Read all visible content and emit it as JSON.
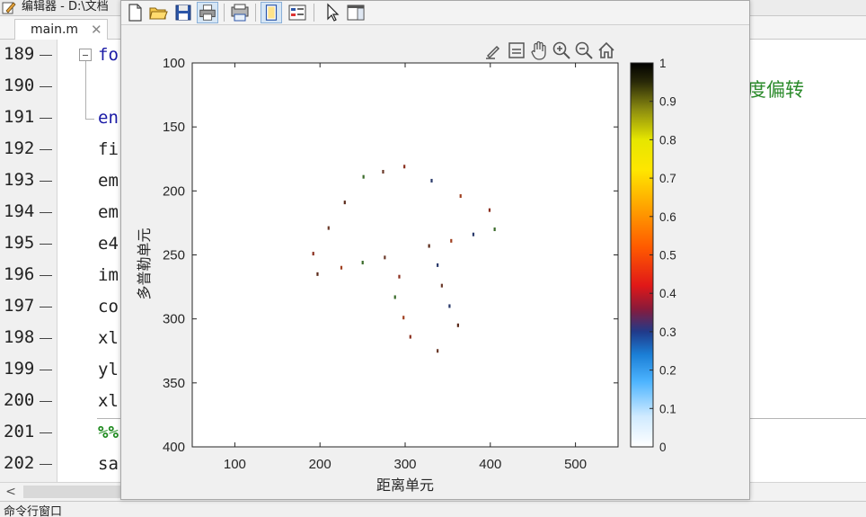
{
  "editor": {
    "title": "编辑器 - D:\\文档",
    "tab": {
      "name": "main.m",
      "close": "✕"
    },
    "lines": [
      {
        "num": "189",
        "code": "fo",
        "kind": "kw"
      },
      {
        "num": "190",
        "code": "",
        "kind": ""
      },
      {
        "num": "191",
        "code": "en",
        "kind": "kw"
      },
      {
        "num": "192",
        "code": "fi",
        "kind": ""
      },
      {
        "num": "193",
        "code": "em",
        "kind": ""
      },
      {
        "num": "194",
        "code": "em",
        "kind": ""
      },
      {
        "num": "195",
        "code": "e4",
        "kind": ""
      },
      {
        "num": "196",
        "code": "im",
        "kind": ""
      },
      {
        "num": "197",
        "code": "co",
        "kind": ""
      },
      {
        "num": "198",
        "code": "xl",
        "kind": ""
      },
      {
        "num": "199",
        "code": "yl",
        "kind": ""
      },
      {
        "num": "200",
        "code": "xl",
        "kind": ""
      },
      {
        "num": "201",
        "code": "%%",
        "kind": "cm"
      },
      {
        "num": "202",
        "code": "sa",
        "kind": ""
      }
    ],
    "comment_fragment": "度偏转",
    "scroll_left": "<",
    "status_text": "命令行窗口"
  },
  "figure": {
    "toolbar": [
      "new-file-icon",
      "open-folder-icon",
      "save-icon",
      "print-icon",
      "print-preview-icon",
      "dock-icon",
      "legend-icon",
      "pointer-icon",
      "property-editor-icon"
    ],
    "axes_tools": [
      "brush-icon",
      "data-tip-icon",
      "pan-icon",
      "zoom-in-icon",
      "zoom-out-icon",
      "home-icon"
    ]
  },
  "chart_data": {
    "type": "scatter",
    "title": "",
    "xlabel": "距离单元",
    "ylabel": "多普勒单元",
    "xlim": [
      50,
      550
    ],
    "ylim": [
      100,
      400
    ],
    "y_reversed": true,
    "x_ticks": [
      100,
      200,
      300,
      400,
      500
    ],
    "y_ticks": [
      100,
      150,
      200,
      250,
      300,
      350,
      400
    ],
    "grid": false,
    "colormap": "hot-jet",
    "colorbar": {
      "min": 0,
      "max": 1,
      "ticks": [
        "0",
        "0.1",
        "0.2",
        "0.3",
        "0.4",
        "0.5",
        "0.6",
        "0.7",
        "0.8",
        "0.9",
        "1"
      ]
    },
    "points": [
      {
        "x": 299,
        "y": 181
      },
      {
        "x": 274,
        "y": 185
      },
      {
        "x": 251,
        "y": 189
      },
      {
        "x": 331,
        "y": 192
      },
      {
        "x": 365,
        "y": 204
      },
      {
        "x": 229,
        "y": 209
      },
      {
        "x": 399,
        "y": 215
      },
      {
        "x": 210,
        "y": 229
      },
      {
        "x": 405,
        "y": 230
      },
      {
        "x": 380,
        "y": 234
      },
      {
        "x": 354,
        "y": 239
      },
      {
        "x": 328,
        "y": 243
      },
      {
        "x": 192,
        "y": 249
      },
      {
        "x": 276,
        "y": 252
      },
      {
        "x": 250,
        "y": 256
      },
      {
        "x": 338,
        "y": 258
      },
      {
        "x": 225,
        "y": 260
      },
      {
        "x": 197,
        "y": 265
      },
      {
        "x": 293,
        "y": 267
      },
      {
        "x": 343,
        "y": 274
      },
      {
        "x": 288,
        "y": 283
      },
      {
        "x": 352,
        "y": 290
      },
      {
        "x": 298,
        "y": 299
      },
      {
        "x": 362,
        "y": 305
      },
      {
        "x": 306,
        "y": 314
      },
      {
        "x": 338,
        "y": 325
      }
    ]
  }
}
